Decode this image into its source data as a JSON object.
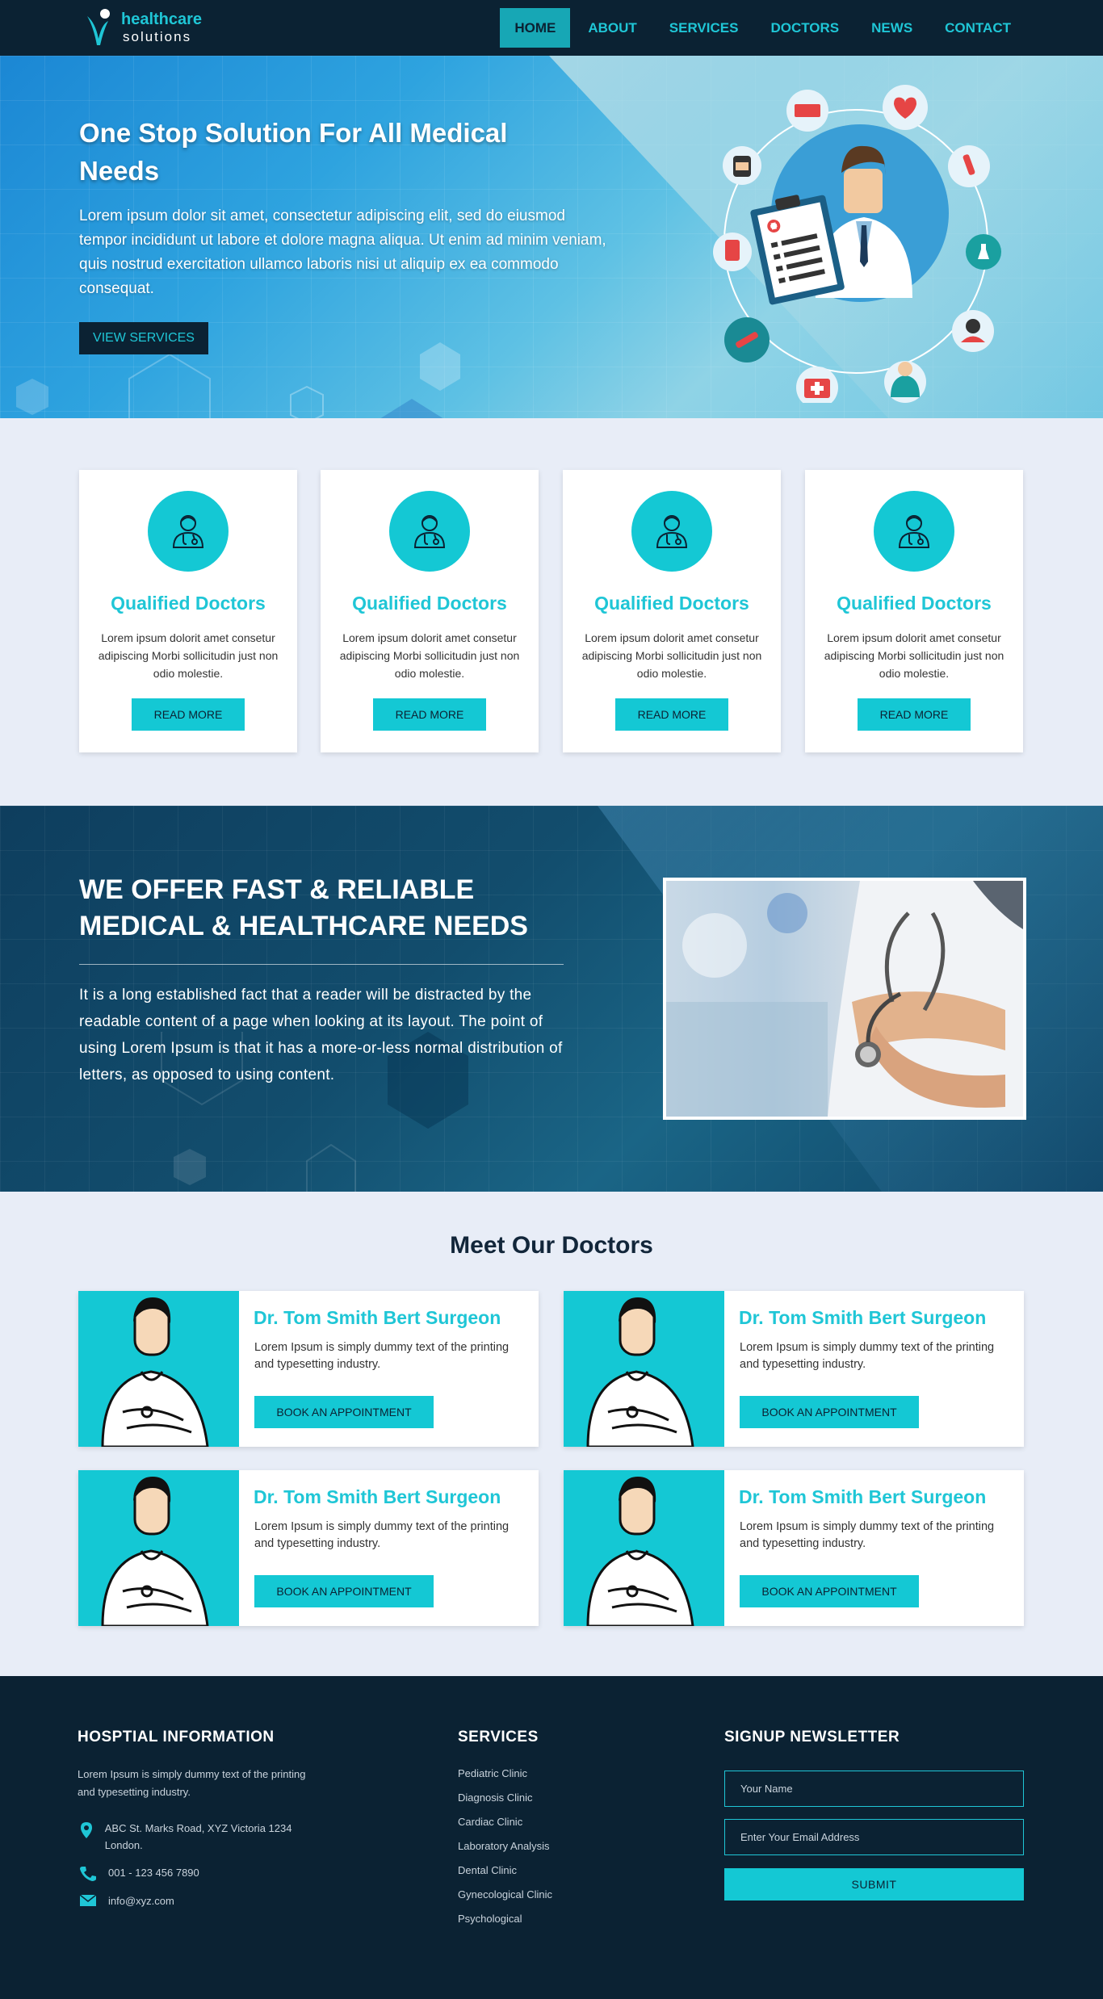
{
  "header": {
    "logo_line1": "healthcare",
    "logo_line2": "solutions",
    "nav": [
      "HOME",
      "ABOUT",
      "SERVICES",
      "DOCTORS",
      "NEWS",
      "CONTACT"
    ],
    "active_nav": "HOME"
  },
  "hero": {
    "title": "One Stop Solution For All Medical Needs",
    "text": "Lorem ipsum dolor sit amet, consectetur adipiscing elit, sed do eiusmod tempor incididunt ut labore et dolore magna aliqua. Ut enim ad minim veniam, quis nostrud exercitation ullamco laboris nisi ut aliquip ex ea commodo consequat.",
    "button": "VIEW SERVICES"
  },
  "features": [
    {
      "title": "Qualified Doctors",
      "text": "Lorem ipsum dolorit amet consetur adipiscing Morbi sollicitudin just non odio molestie.",
      "button": "READ MORE"
    },
    {
      "title": "Qualified Doctors",
      "text": "Lorem ipsum dolorit amet consetur adipiscing Morbi sollicitudin just non odio molestie.",
      "button": "READ MORE"
    },
    {
      "title": "Qualified Doctors",
      "text": "Lorem ipsum dolorit amet consetur adipiscing Morbi sollicitudin just non odio molestie.",
      "button": "READ MORE"
    },
    {
      "title": "Qualified Doctors",
      "text": "Lorem ipsum dolorit amet consetur adipiscing Morbi sollicitudin just non odio molestie.",
      "button": "READ MORE"
    }
  ],
  "offer": {
    "title": "WE OFFER FAST & RELIABLE MEDICAL & HEALTHCARE NEEDS",
    "text": "It is a long established fact that a reader will be distracted by the readable content of a page when looking at its layout. The point of using Lorem Ipsum is that it has a more-or-less normal distribution of letters, as opposed to using content."
  },
  "doctors": {
    "heading": "Meet Our Doctors",
    "cards": [
      {
        "name": "Dr. Tom Smith Bert Surgeon",
        "text": "Lorem Ipsum is simply dummy text of the printing and typesetting industry.",
        "button": "BOOK AN APPOINTMENT"
      },
      {
        "name": "Dr. Tom Smith Bert Surgeon",
        "text": "Lorem Ipsum is simply dummy text of the printing and typesetting industry.",
        "button": "BOOK AN APPOINTMENT"
      },
      {
        "name": "Dr. Tom Smith Bert Surgeon",
        "text": "Lorem Ipsum is simply dummy text of the printing and typesetting industry.",
        "button": "BOOK AN APPOINTMENT"
      },
      {
        "name": "Dr. Tom Smith Bert Surgeon",
        "text": "Lorem Ipsum is simply dummy text of the printing and typesetting industry.",
        "button": "BOOK AN APPOINTMENT"
      }
    ]
  },
  "footer": {
    "info_heading": "HOSPTIAL INFORMATION",
    "info_text": "Lorem Ipsum is simply dummy text of the printing and typesetting industry.",
    "address": "ABC St. Marks Road, XYZ Victoria 1234 London.",
    "phone": "001 - 123 456 7890",
    "email": "info@xyz.com",
    "services_heading": "SERVICES",
    "services": [
      "Pediatric Clinic",
      "Diagnosis Clinic",
      "Cardiac Clinic",
      "Laboratory Analysis",
      "Dental Clinic",
      "Gynecological Clinic",
      "Psychological"
    ],
    "newsletter_heading": "SIGNUP NEWSLETTER",
    "name_placeholder": "Your Name",
    "email_placeholder": "Enter Your Email Address",
    "submit": "SUBMIT"
  },
  "colors": {
    "accent": "#14c8d4",
    "dark": "#0b2233",
    "hero_blue": "#2ea3df"
  }
}
